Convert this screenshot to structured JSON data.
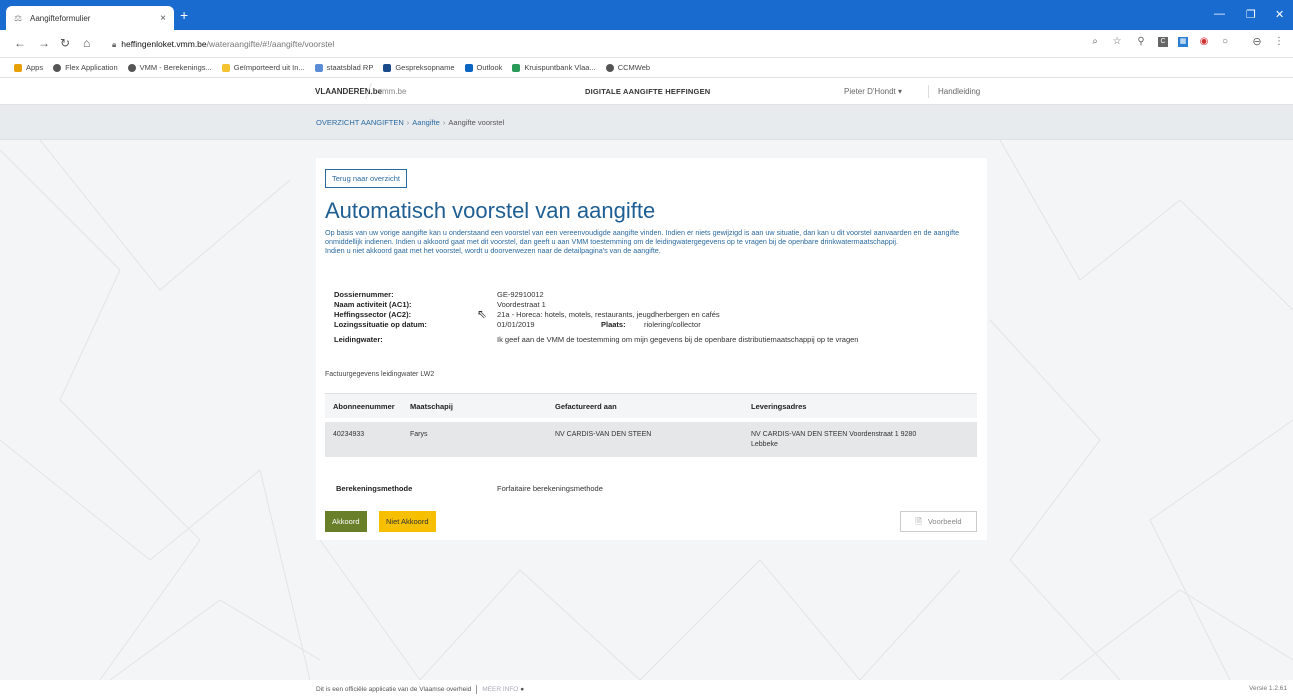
{
  "browser": {
    "tab_title": "Aangifteformulier",
    "tab_close": "×",
    "new_tab": "+",
    "url_host": "heffingenloket.vmm.be",
    "url_path": "/wateraangifte/#!/aangifte/voorstel",
    "bookmarks": [
      "Apps",
      "Flex Application",
      "VMM - Berekenings...",
      "Geïmporteerd uit In...",
      "staatsblad RP",
      "Gespreksopname",
      "Outlook",
      "Kruispuntbank Vlaa...",
      "CCMWeb"
    ]
  },
  "header": {
    "brand": "VLAANDEREN.be",
    "vmm": "vmm.be",
    "app_title": "DIGITALE AANGIFTE HEFFINGEN",
    "user": "Pieter D'Hondt ▾",
    "manual": "Handleiding"
  },
  "breadcrumb": {
    "item1": "OVERZICHT AANGIFTEN",
    "item2": "Aangifte",
    "current": "Aangifte voorstel",
    "separator": "›"
  },
  "card": {
    "back_button": "Terug naar overzicht",
    "title": "Automatisch voorstel van aangifte",
    "intro1": "Op basis van uw vorige aangifte kan u onderstaand een voorstel van een vereenvoudigde aangifte vinden. Indien er niets gewijzigd is aan uw situatie, dan kan u dit voorstel aanvaarden en de aangifte onmiddellijk indienen. Indien u akkoord gaat met dit voorstel, dan geeft u aan VMM toestemming om de leidingwatergegevens op te vragen bij de openbare drinkwatermaatschappij.",
    "intro2": "Indien u niet akkoord gaat met het voorstel, wordt u doorverwezen naar de detailpagina's van de aangifte."
  },
  "details": {
    "dossier_label": "Dossiernummer:",
    "dossier_value": "GE-92910012",
    "activity_label": "Naam activiteit (AC1):",
    "activity_value": "Voordestraat 1",
    "sector_label": "Heffingssector (AC2):",
    "sector_value": "21a - Horeca: hotels, motels, restaurants, jeugdherbergen en cafés",
    "lozing_label": "Lozingssituatie op datum:",
    "lozing_value": "01/01/2019",
    "plaats_label": "Plaats:",
    "plaats_value": "riolering/collector",
    "leidingwater_label": "Leidingwater:",
    "leidingwater_value": "Ik geef aan de VMM de toestemming om mijn gegevens bij de openbare distributiemaatschappij op te vragen"
  },
  "invoice": {
    "section_label": "Factuurgegevens leidingwater LW2",
    "headers": [
      "Abonneenummer",
      "Maatschapij",
      "Gefactureerd aan",
      "Leveringsadres"
    ],
    "row": {
      "abonnee": "40234933",
      "maatschappij": "Farys",
      "gefactureerd": "NV CARDIS-VAN DEN STEEN",
      "adres_line1": "NV CARDIS-VAN DEN STEEN Voordenstraat 1 9280",
      "adres_line2": "Lebbeke"
    }
  },
  "calculation": {
    "label": "Berekeningsmethode",
    "value": "Forfaitaire berekeningsmethode"
  },
  "actions": {
    "akkoord": "Akkoord",
    "niet_akkoord": "Niet Akkoord",
    "voorbeeld": "Voorbeeld"
  },
  "footer": {
    "text": "Dit is een officiële applicatie van de Vlaamse overheid",
    "more": "MEER INFO",
    "version": "Versie 1.2.61"
  },
  "colors": {
    "chrome_blue": "#1a6bd0",
    "title_blue": "#1f5e92",
    "accept_green": "#6a7f2a",
    "reject_yellow": "#f6c000"
  }
}
